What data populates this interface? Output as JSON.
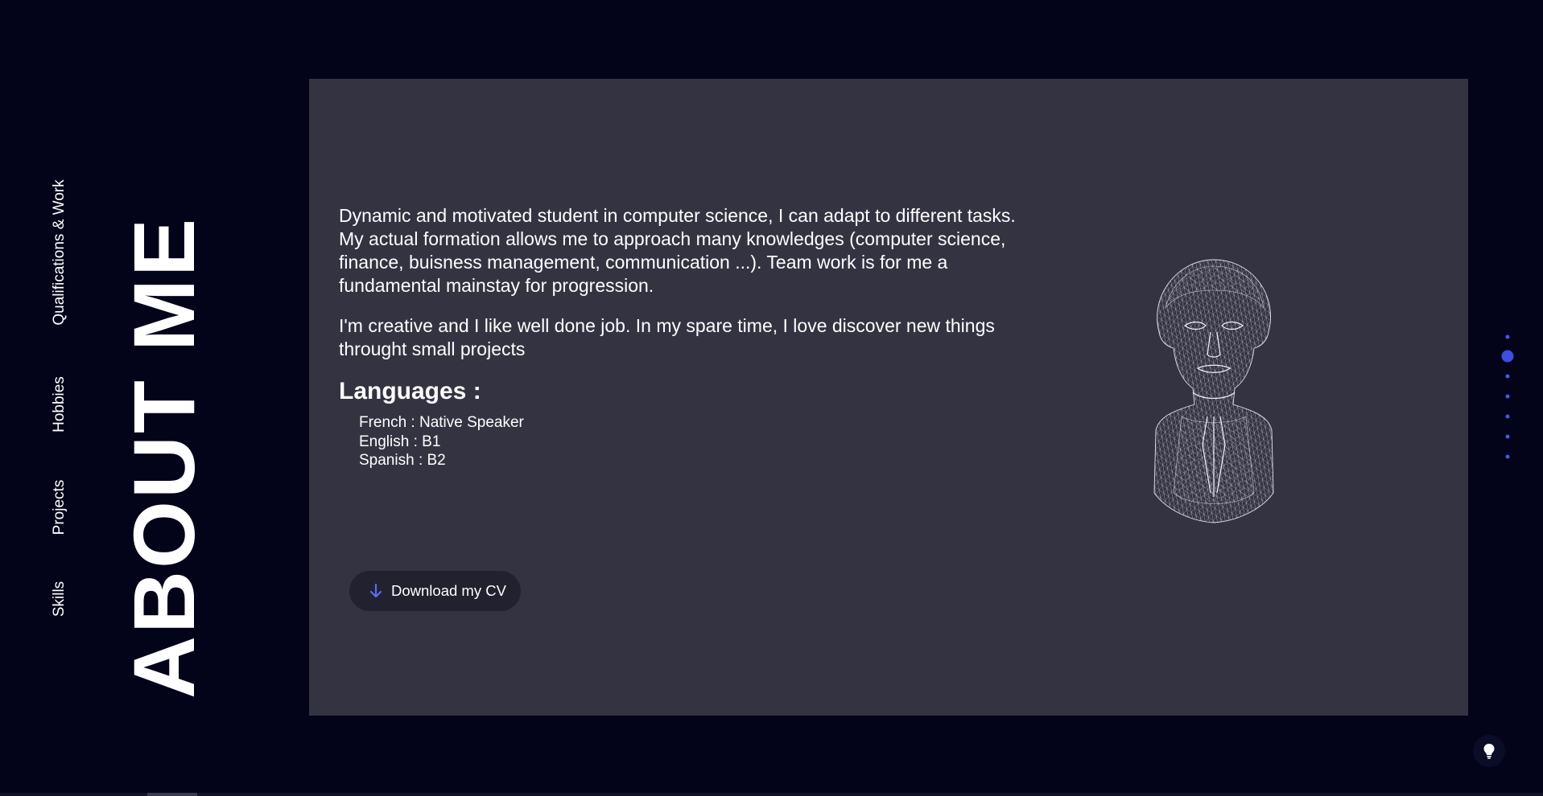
{
  "nav": {
    "items": [
      {
        "label": "Qualifications & Work"
      },
      {
        "label": "Hobbies"
      },
      {
        "label": "Projects"
      },
      {
        "label": "Skills"
      }
    ]
  },
  "page": {
    "title": "ABOUT ME"
  },
  "about": {
    "paragraph1": "Dynamic and motivated student in computer science, I can adapt to different tasks. My actual formation allows me to approach many knowledges (computer science, finance, buisness management, communication ...). Team work is for me a fundamental mainstay for progression.",
    "paragraph2": "I'm creative and I like well done job. In my spare time, I love discover new things throught small projects",
    "languages_title": "Languages :",
    "languages": [
      {
        "text": "French : Native Speaker"
      },
      {
        "text": "English : B1"
      },
      {
        "text": "Spanish : B2"
      }
    ],
    "cv_button": "Download my CV"
  },
  "pager": {
    "count": 7,
    "active_index": 1
  },
  "colors": {
    "background": "#03031a",
    "panel": "#343342",
    "accent": "#3d4ee0",
    "button": "#21212f"
  },
  "icons": {
    "cv_button": "arrow-down-icon",
    "theme_toggle": "lightbulb-icon",
    "illustration": "wireframe-head-bust"
  }
}
